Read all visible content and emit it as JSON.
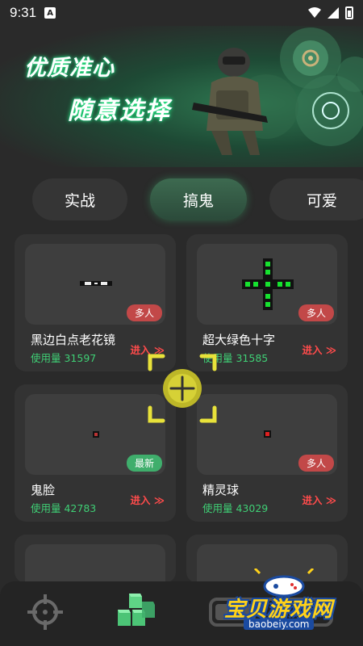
{
  "status": {
    "time": "9:31",
    "notification_icon": "A"
  },
  "banner": {
    "line1": "优质准心",
    "line2": "随意选择"
  },
  "tabs": [
    {
      "label": "实战",
      "active": false
    },
    {
      "label": "搞鬼",
      "active": true
    },
    {
      "label": "可爱",
      "active": false
    }
  ],
  "cards": [
    {
      "name": "黑边白点老花镜",
      "usage": "使用量 31597",
      "badge": "多人",
      "enter": "进入 ≫"
    },
    {
      "name": "超大绿色十字",
      "usage": "使用量 31585",
      "badge": "多人",
      "enter": "进入 ≫"
    },
    {
      "name": "鬼脸",
      "usage": "使用量 42783",
      "badge": "最新",
      "enter": "进入 ≫"
    },
    {
      "name": "精灵球",
      "usage": "使用量 43029",
      "badge": "多人",
      "enter": "进入 ≫"
    }
  ],
  "watermark": {
    "text": "宝贝游戏网",
    "url": "baobeiy.com"
  },
  "colors": {
    "accent_green": "#3fcf75",
    "badge_red": "#c24848",
    "badge_green": "#3fae6c",
    "enter_red": "#ff4b4b"
  }
}
